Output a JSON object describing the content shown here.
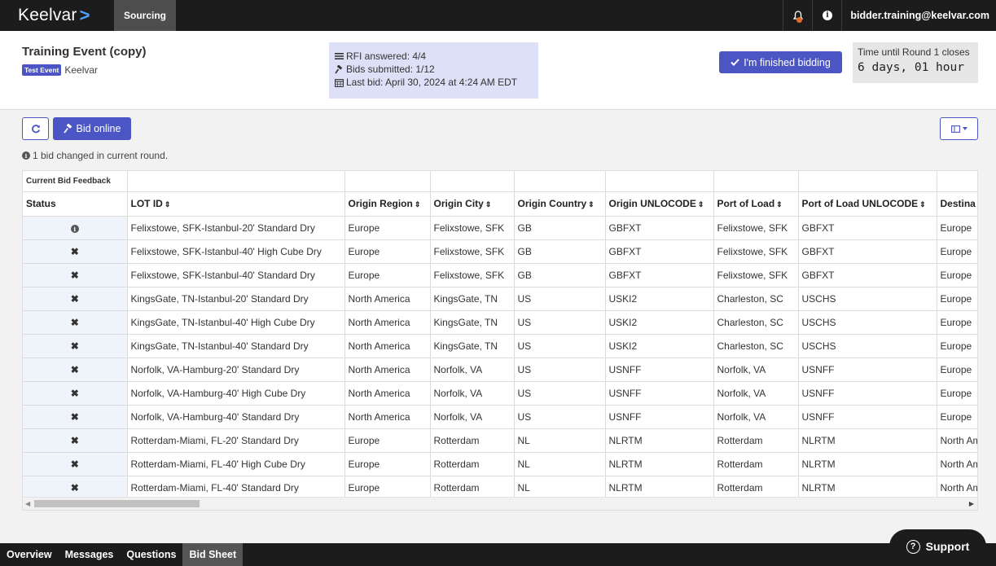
{
  "topnav": {
    "brand": "Keelvar",
    "brand_chevron": ">",
    "tab": "Sourcing",
    "user_email": "bidder.training@keelvar.com"
  },
  "event": {
    "title": "Training Event (copy)",
    "badge": "Test Event",
    "org": "Keelvar"
  },
  "stats": {
    "rfi": "RFI answered: 4/4",
    "bids": "Bids submitted: 1/12",
    "last_bid": "Last bid: April 30, 2024 at 4:24 AM EDT"
  },
  "finish_button": "I'm finished bidding",
  "timer": {
    "label": "Time until Round 1 closes",
    "value": "6 days, 01 hour"
  },
  "toolbar": {
    "bid_online": "Bid online",
    "notice": "1 bid changed in current round."
  },
  "table": {
    "group_header": "Current Bid Feedback",
    "columns": [
      "Status",
      "LOT ID",
      "Origin Region",
      "Origin City",
      "Origin Country",
      "Origin UNLOCODE",
      "Port of Load",
      "Port of Load UNLOCODE",
      "Destina"
    ],
    "rows": [
      {
        "status": "info",
        "lot": "Felixstowe, SFK-Istanbul-20' Standard Dry",
        "region": "Europe",
        "city": "Felixstowe, SFK",
        "country": "GB",
        "unlocode": "GBFXT",
        "pol": "Felixstowe, SFK",
        "pol_code": "GBFXT",
        "dest": "Europe"
      },
      {
        "status": "x",
        "lot": "Felixstowe, SFK-Istanbul-40' High Cube Dry",
        "region": "Europe",
        "city": "Felixstowe, SFK",
        "country": "GB",
        "unlocode": "GBFXT",
        "pol": "Felixstowe, SFK",
        "pol_code": "GBFXT",
        "dest": "Europe"
      },
      {
        "status": "x",
        "lot": "Felixstowe, SFK-Istanbul-40' Standard Dry",
        "region": "Europe",
        "city": "Felixstowe, SFK",
        "country": "GB",
        "unlocode": "GBFXT",
        "pol": "Felixstowe, SFK",
        "pol_code": "GBFXT",
        "dest": "Europe"
      },
      {
        "status": "x",
        "lot": "KingsGate, TN-Istanbul-20' Standard Dry",
        "region": "North America",
        "city": "KingsGate, TN",
        "country": "US",
        "unlocode": "USKI2",
        "pol": "Charleston, SC",
        "pol_code": "USCHS",
        "dest": "Europe"
      },
      {
        "status": "x",
        "lot": "KingsGate, TN-Istanbul-40' High Cube Dry",
        "region": "North America",
        "city": "KingsGate, TN",
        "country": "US",
        "unlocode": "USKI2",
        "pol": "Charleston, SC",
        "pol_code": "USCHS",
        "dest": "Europe"
      },
      {
        "status": "x",
        "lot": "KingsGate, TN-Istanbul-40' Standard Dry",
        "region": "North America",
        "city": "KingsGate, TN",
        "country": "US",
        "unlocode": "USKI2",
        "pol": "Charleston, SC",
        "pol_code": "USCHS",
        "dest": "Europe"
      },
      {
        "status": "x",
        "lot": "Norfolk, VA-Hamburg-20' Standard Dry",
        "region": "North America",
        "city": "Norfolk, VA",
        "country": "US",
        "unlocode": "USNFF",
        "pol": "Norfolk, VA",
        "pol_code": "USNFF",
        "dest": "Europe"
      },
      {
        "status": "x",
        "lot": "Norfolk, VA-Hamburg-40' High Cube Dry",
        "region": "North America",
        "city": "Norfolk, VA",
        "country": "US",
        "unlocode": "USNFF",
        "pol": "Norfolk, VA",
        "pol_code": "USNFF",
        "dest": "Europe"
      },
      {
        "status": "x",
        "lot": "Norfolk, VA-Hamburg-40' Standard Dry",
        "region": "North America",
        "city": "Norfolk, VA",
        "country": "US",
        "unlocode": "USNFF",
        "pol": "Norfolk, VA",
        "pol_code": "USNFF",
        "dest": "Europe"
      },
      {
        "status": "x",
        "lot": "Rotterdam-Miami, FL-20' Standard Dry",
        "region": "Europe",
        "city": "Rotterdam",
        "country": "NL",
        "unlocode": "NLRTM",
        "pol": "Rotterdam",
        "pol_code": "NLRTM",
        "dest": "North Am"
      },
      {
        "status": "x",
        "lot": "Rotterdam-Miami, FL-40' High Cube Dry",
        "region": "Europe",
        "city": "Rotterdam",
        "country": "NL",
        "unlocode": "NLRTM",
        "pol": "Rotterdam",
        "pol_code": "NLRTM",
        "dest": "North Am"
      },
      {
        "status": "x",
        "lot": "Rotterdam-Miami, FL-40' Standard Dry",
        "region": "Europe",
        "city": "Rotterdam",
        "country": "NL",
        "unlocode": "NLRTM",
        "pol": "Rotterdam",
        "pol_code": "NLRTM",
        "dest": "North Am"
      }
    ]
  },
  "bottom_tabs": [
    "Overview",
    "Messages",
    "Questions",
    "Bid Sheet"
  ],
  "support_label": "Support",
  "colors": {
    "accent": "#4b56c4",
    "navbar": "#1c1c1c",
    "stats_bg": "#dde0f6",
    "status_cell_bg": "#eef4f9",
    "notification_dot": "#e06a2b"
  }
}
